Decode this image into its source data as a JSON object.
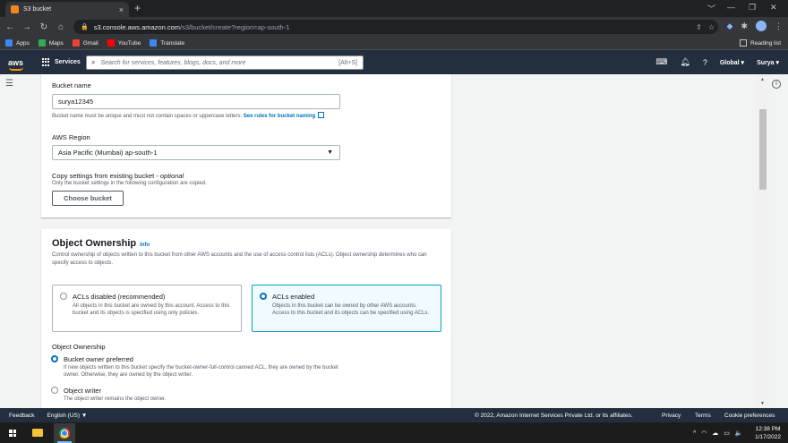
{
  "browser": {
    "tab_title": "S3 bucket",
    "tab_close": "×",
    "new_tab": "+",
    "window_controls": [
      "﹀",
      "—",
      "❐",
      "✕"
    ],
    "url_host": "s3.console.aws.amazon.com",
    "url_path": "/s3/bucket/create?region=ap-south-1",
    "bookmarks": [
      {
        "label": "Apps",
        "color": "#4285f4"
      },
      {
        "label": "Maps",
        "color": "#34a853"
      },
      {
        "label": "Gmail",
        "color": "#ea4335"
      },
      {
        "label": "YouTube",
        "color": "#ff0000"
      },
      {
        "label": "Translate",
        "color": "#4285f4"
      }
    ],
    "reading_list": "Reading list"
  },
  "aws_nav": {
    "logo": "aws",
    "services": "Services",
    "search_placeholder": "Search for services, features, blogs, docs, and more",
    "search_shortcut": "[Alt+S]",
    "region": "Global ▾",
    "user": "Surya ▾"
  },
  "general": {
    "bucket_name_label": "Bucket name",
    "bucket_name_value": "surya12345",
    "bucket_name_help": "Bucket name must be unique and must not contain spaces or uppercase letters.",
    "bucket_name_link": "See rules for bucket naming",
    "region_label": "AWS Region",
    "region_value": "Asia Pacific (Mumbai) ap-south-1",
    "copy_label": "Copy settings from existing bucket",
    "copy_optional": " - optional",
    "copy_help": "Only the bucket settings in the following configuration are copied.",
    "choose_bucket": "Choose bucket"
  },
  "ownership": {
    "title": "Object Ownership",
    "info": "Info",
    "description": "Control ownership of objects written to this bucket from other AWS accounts and the use of access control lists (ACLs). Object ownership determines who can specify access to objects.",
    "acl_disabled_title": "ACLs disabled (recommended)",
    "acl_disabled_desc": "All objects in this bucket are owned by this account. Access to this bucket and its objects is specified using only policies.",
    "acl_enabled_title": "ACLs enabled",
    "acl_enabled_desc": "Objects in this bucket can be owned by other AWS accounts. Access to this bucket and its objects can be specified using ACLs.",
    "sub_label": "Object Ownership",
    "opt1_title": "Bucket owner preferred",
    "opt1_desc": "If new objects written to this bucket specify the bucket-owner-full-control canned ACL, they are owned by the bucket owner. Otherwise, they are owned by the object writer.",
    "opt2_title": "Object writer",
    "opt2_desc": "The object writer remains the object owner."
  },
  "footer": {
    "feedback": "Feedback",
    "language": "English (US) ▼",
    "copyright": "© 2022, Amazon Internet Services Private Ltd. or its affiliates.",
    "privacy": "Privacy",
    "terms": "Terms",
    "cookies": "Cookie preferences"
  },
  "taskbar": {
    "tray": "^ ◠ ☁ ▭ 🔈",
    "time": "12:38 PM",
    "date": "1/17/2022"
  },
  "colors": {
    "aws_nav": "#232f3e",
    "aws_orange": "#ff9900",
    "link": "#0073bb",
    "selected_border": "#00a1c9"
  }
}
